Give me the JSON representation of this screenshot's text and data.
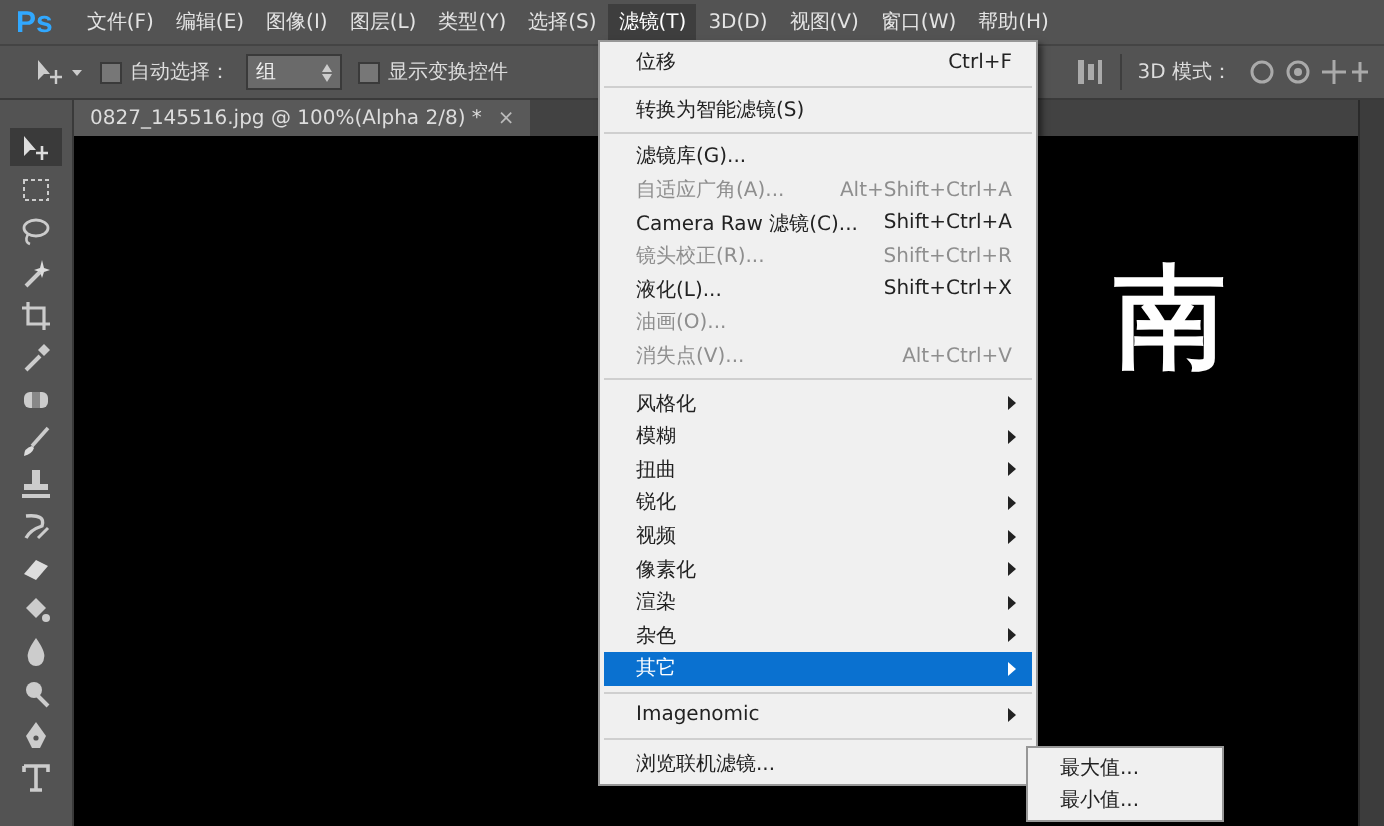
{
  "app": {
    "logo": "Ps"
  },
  "menubar": [
    {
      "label": "文件(F)",
      "selected": false
    },
    {
      "label": "编辑(E)",
      "selected": false
    },
    {
      "label": "图像(I)",
      "selected": false
    },
    {
      "label": "图层(L)",
      "selected": false
    },
    {
      "label": "类型(Y)",
      "selected": false
    },
    {
      "label": "选择(S)",
      "selected": false
    },
    {
      "label": "滤镜(T)",
      "selected": true
    },
    {
      "label": "3D(D)",
      "selected": false
    },
    {
      "label": "视图(V)",
      "selected": false
    },
    {
      "label": "窗口(W)",
      "selected": false
    },
    {
      "label": "帮助(H)",
      "selected": false
    }
  ],
  "options_bar": {
    "auto_select": {
      "label": "自动选择：",
      "checked": false
    },
    "auto_select_target": "组",
    "show_transform": {
      "label": "显示变换控件",
      "checked": false
    },
    "mode_3d": "3D 模式："
  },
  "document_tab": {
    "title": "0827_145516.jpg @ 100%(Alpha 2/8) *",
    "close": "×"
  },
  "toolbox": {
    "tools": [
      {
        "kind": "move",
        "selected": true
      },
      {
        "kind": "marquee",
        "selected": false
      },
      {
        "kind": "lasso",
        "selected": false
      },
      {
        "kind": "wand",
        "selected": false
      },
      {
        "kind": "crop",
        "selected": false
      },
      {
        "kind": "eyedropper",
        "selected": false
      },
      {
        "kind": "healing",
        "selected": false
      },
      {
        "kind": "brush",
        "selected": false
      },
      {
        "kind": "stamp",
        "selected": false
      },
      {
        "kind": "history",
        "selected": false
      },
      {
        "kind": "eraser",
        "selected": false
      },
      {
        "kind": "bucket",
        "selected": false
      },
      {
        "kind": "blur",
        "selected": false
      },
      {
        "kind": "dodge",
        "selected": false
      },
      {
        "kind": "pen",
        "selected": false
      },
      {
        "kind": "type",
        "selected": false
      }
    ]
  },
  "canvas": {
    "text": "南"
  },
  "filter_menu": [
    {
      "kind": "item",
      "label": "位移",
      "shortcut": "Ctrl+F",
      "disabled": false,
      "submenu": false,
      "selected": false
    },
    {
      "kind": "separator"
    },
    {
      "kind": "item",
      "label": "转换为智能滤镜(S)",
      "disabled": false,
      "submenu": false,
      "selected": false
    },
    {
      "kind": "separator"
    },
    {
      "kind": "item",
      "label": "滤镜库(G)...",
      "disabled": false,
      "submenu": false,
      "selected": false
    },
    {
      "kind": "item",
      "label": "自适应广角(A)...",
      "shortcut": "Alt+Shift+Ctrl+A",
      "disabled": true,
      "submenu": false,
      "selected": false
    },
    {
      "kind": "item",
      "label": "Camera Raw 滤镜(C)...",
      "shortcut": "Shift+Ctrl+A",
      "disabled": false,
      "submenu": false,
      "selected": false
    },
    {
      "kind": "item",
      "label": "镜头校正(R)...",
      "shortcut": "Shift+Ctrl+R",
      "disabled": true,
      "submenu": false,
      "selected": false
    },
    {
      "kind": "item",
      "label": "液化(L)...",
      "shortcut": "Shift+Ctrl+X",
      "disabled": false,
      "submenu": false,
      "selected": false
    },
    {
      "kind": "item",
      "label": "油画(O)...",
      "disabled": true,
      "submenu": false,
      "selected": false
    },
    {
      "kind": "item",
      "label": "消失点(V)...",
      "shortcut": "Alt+Ctrl+V",
      "disabled": true,
      "submenu": false,
      "selected": false
    },
    {
      "kind": "separator"
    },
    {
      "kind": "item",
      "label": "风格化",
      "disabled": false,
      "submenu": true,
      "selected": false
    },
    {
      "kind": "item",
      "label": "模糊",
      "disabled": false,
      "submenu": true,
      "selected": false
    },
    {
      "kind": "item",
      "label": "扭曲",
      "disabled": false,
      "submenu": true,
      "selected": false
    },
    {
      "kind": "item",
      "label": "锐化",
      "disabled": false,
      "submenu": true,
      "selected": false
    },
    {
      "kind": "item",
      "label": "视频",
      "disabled": false,
      "submenu": true,
      "selected": false
    },
    {
      "kind": "item",
      "label": "像素化",
      "disabled": false,
      "submenu": true,
      "selected": false
    },
    {
      "kind": "item",
      "label": "渲染",
      "disabled": false,
      "submenu": true,
      "selected": false
    },
    {
      "kind": "item",
      "label": "杂色",
      "disabled": false,
      "submenu": true,
      "selected": false
    },
    {
      "kind": "item",
      "label": "其它",
      "disabled": false,
      "submenu": true,
      "selected": true
    },
    {
      "kind": "separator"
    },
    {
      "kind": "item",
      "label": "Imagenomic",
      "disabled": false,
      "submenu": true,
      "selected": false
    },
    {
      "kind": "separator"
    },
    {
      "kind": "item",
      "label": "浏览联机滤镜...",
      "disabled": false,
      "submenu": false,
      "selected": false
    }
  ],
  "other_submenu": [
    "最大值...",
    "最小值..."
  ]
}
